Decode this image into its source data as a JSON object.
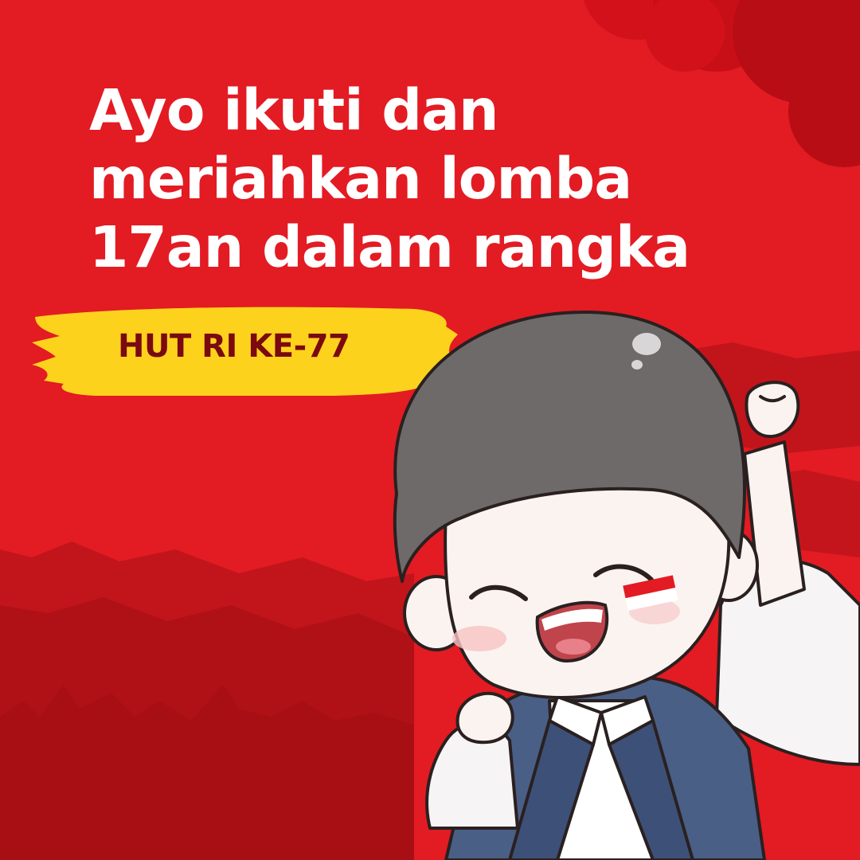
{
  "poster": {
    "headline_lines": [
      "Ayo ikuti dan",
      "meriahkan lomba",
      "17an dalam rangka"
    ],
    "badge_text": "HUT RI KE-77"
  },
  "colors": {
    "background_red": "#e31b23",
    "dark_red": "#a80f15",
    "badge_yellow": "#fcd21c",
    "badge_text": "#7a0a10",
    "headline_text": "#ffffff",
    "jacket_blue": "#4a5f86"
  },
  "illustration": {
    "subject": "cheering-chibi-boy",
    "cheek_flag_colors": [
      "#e31b23",
      "#ffffff"
    ]
  }
}
